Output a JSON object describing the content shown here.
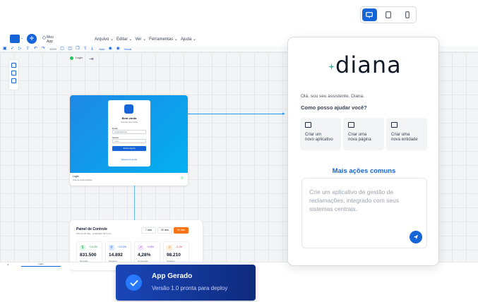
{
  "device_switcher": {
    "options": [
      "desktop-icon",
      "tablet-icon",
      "mobile-icon"
    ],
    "active": "desktop",
    "accent": "#1565d8"
  },
  "editor": {
    "app_name": "Meu App",
    "menu": [
      "Arquivo ⌄",
      "Editar ⌄",
      "Ver ⌄",
      "Ferramentas ⌄",
      "Ajuda ⌄"
    ],
    "toolbar_zoom": "100%",
    "toolbar_status": "Auto",
    "toolbar_visual": "Visual"
  },
  "canvas": {
    "login_node_label": "Login",
    "login_card": {
      "title": "Bem-vindo",
      "subtitle": "Acesse sua conta",
      "email_label": "Email",
      "email_placeholder": "seu@email.com",
      "password_label": "Senha",
      "password_placeholder": "••••••••",
      "submit": "Entrar Agora",
      "forgot": "Esqueci a senha",
      "footer_title": "Login",
      "footer_subtitle": "Tela de autenticação"
    },
    "dashboard": {
      "title": "Painel de Controle",
      "subtitle": "Últimos 30 dias · Atualizado há 5 min",
      "ranges": [
        "7 dias",
        "30 dias",
        "90 dias"
      ],
      "active_range": "90 dias",
      "kpis": [
        {
          "icon": "$",
          "change": "+14,3%",
          "value": "831.500",
          "label": "Receitas",
          "color": "#16a34a",
          "bg": "#dcfce7"
        },
        {
          "icon": "👤",
          "change": "+12,5%",
          "value": "14.892",
          "label": "Usuários",
          "color": "#2563eb",
          "bg": "#dbeafe"
        },
        {
          "icon": "↗",
          "change": "+0,8%",
          "value": "4,28%",
          "label": "Conversão",
          "color": "#9333ea",
          "bg": "#f3e8ff"
        },
        {
          "icon": "⚡",
          "change": "-2,1%",
          "value": "98.210",
          "label": "Sessões",
          "color": "#dc2626",
          "bg": "#ffedd5"
        }
      ]
    },
    "tab_label": "Login"
  },
  "assistant": {
    "logo": "diana",
    "greeting": "Olá, sou seu assistente, Diana.",
    "question": "Como posso ajudar você?",
    "suggestions": [
      {
        "icon": "folder-icon",
        "line1": "Criar um",
        "line2": "novo aplicativo"
      },
      {
        "icon": "page-icon",
        "line1": "Criar uma",
        "line2": "nova página"
      },
      {
        "icon": "entity-icon",
        "line1": "Criar uma",
        "line2": "nova entidade"
      }
    ],
    "more_actions": "Mais ações comuns",
    "prompt_placeholder": "Crie um aplicativo de gestão de reclamações, integrado com seus sistemas centrais.",
    "accent": "#1565d8"
  },
  "toast": {
    "title": "App Gerado",
    "message": "Versão 1.0 pronta para deploy"
  }
}
